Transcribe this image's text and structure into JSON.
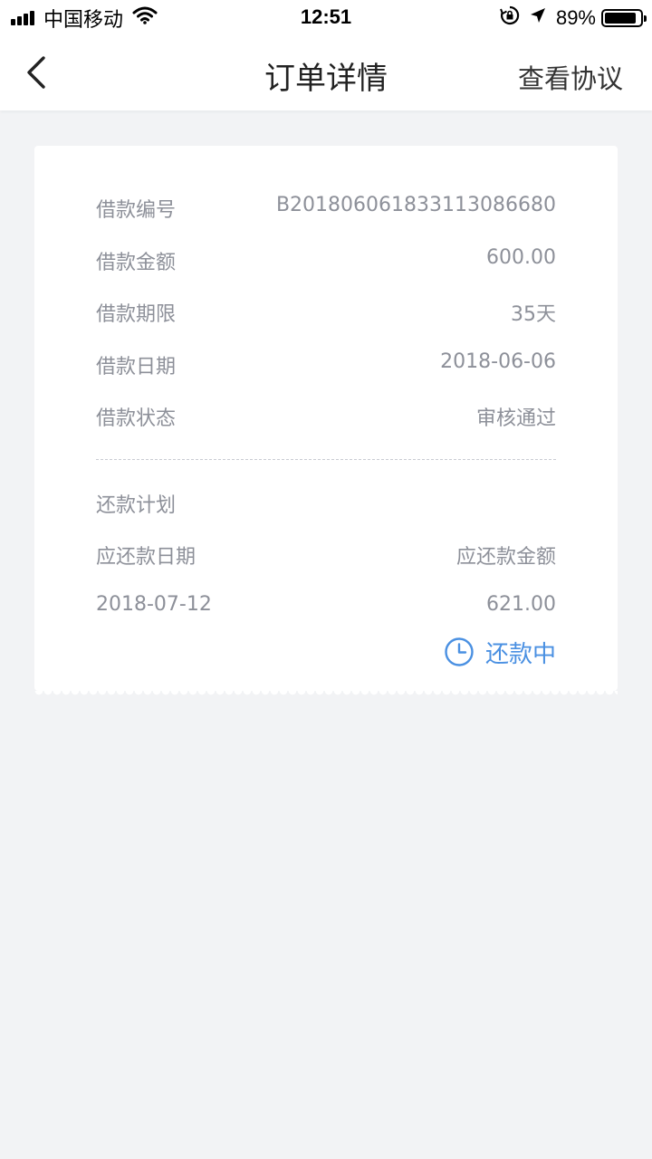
{
  "status_bar": {
    "carrier": "中国移动",
    "time": "12:51",
    "battery": "89%",
    "battery_level": 0.89,
    "icons": [
      "signal-icon",
      "wifi-icon",
      "rotation-lock-icon",
      "location-arrow-icon",
      "battery-icon"
    ]
  },
  "nav": {
    "back_icon": "chevron-left-icon",
    "title": "订单详情",
    "right_action": "查看协议"
  },
  "order": {
    "fields": [
      {
        "label": "借款编号",
        "value": "B20180606183311308668​0"
      },
      {
        "label": "借款金额",
        "value": "600.00"
      },
      {
        "label": "借款期限",
        "value": "35天"
      },
      {
        "label": "借款日期",
        "value": "2018-06-06"
      },
      {
        "label": "借款状态",
        "value": "审核通过"
      }
    ],
    "plan": {
      "title": "还款计划",
      "header_date": "应还款日期",
      "header_amount": "应还款金额",
      "rows": [
        {
          "date": "2018-07-12",
          "amount": "621.00"
        }
      ],
      "status": "还款中",
      "status_icon": "clock-icon",
      "status_color": "#4a90e2"
    }
  }
}
